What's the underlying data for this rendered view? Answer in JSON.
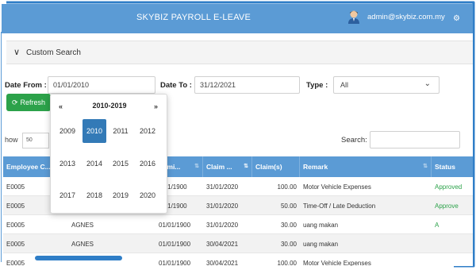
{
  "header": {
    "title": "SKYBIZ PAYROLL E-LEAVE",
    "user_email": "admin@skybiz.com.my",
    "icons": {
      "avatar": "user-avatar-icon",
      "settings": "gear-icon"
    },
    "colors": {
      "header_bg": "#5b9bd5"
    }
  },
  "search_panel": {
    "label": "Custom Search",
    "icon": "chevron-down-icon"
  },
  "filters": {
    "date_from": {
      "label": "Date From :",
      "value": "01/01/2010"
    },
    "date_to": {
      "label": "Date To :",
      "value": "31/12/2021"
    },
    "type": {
      "label": "Type :",
      "value": "All"
    }
  },
  "refresh_button": {
    "label": "Refresh",
    "icon": "refresh-icon",
    "color": "#2ca24a"
  },
  "table_controls": {
    "show_label": "how",
    "page_size": "50",
    "search_label": "Search:"
  },
  "datepicker": {
    "prev": "«",
    "next": "»",
    "title": "2010-2019",
    "years": [
      "2009",
      "2010",
      "2011",
      "2012",
      "2013",
      "2014",
      "2015",
      "2016",
      "2017",
      "2018",
      "2019",
      "2020"
    ],
    "selected": "2010"
  },
  "table": {
    "columns": [
      "Employee C...",
      "",
      "ubmi...",
      "Claim ...",
      "Claim(s)",
      "Remark",
      "Status"
    ],
    "rows": [
      {
        "employee": "E0005",
        "name": "",
        "submit": "1/01/1900",
        "claim_date": "31/01/2020",
        "amount": "100.00",
        "remark": "Motor Vehicle Expenses",
        "status": "Approved"
      },
      {
        "employee": "E0005",
        "name": "",
        "submit": "1/01/1900",
        "claim_date": "31/01/2020",
        "amount": "50.00",
        "remark": "Time-Off / Late Deduction",
        "status": "Approve"
      },
      {
        "employee": "E0005",
        "name": "AGNES",
        "submit": "01/01/1900",
        "claim_date": "31/01/2020",
        "amount": "30.00",
        "remark": "uang makan",
        "status": "A"
      },
      {
        "employee": "E0005",
        "name": "AGNES",
        "submit": "01/01/1900",
        "claim_date": "30/04/2021",
        "amount": "30.00",
        "remark": "uang makan",
        "status": ""
      },
      {
        "employee": "E0005",
        "name": "",
        "submit": "01/01/1900",
        "claim_date": "30/04/2021",
        "amount": "100.00",
        "remark": "Motor Vehicle Expenses",
        "status": ""
      }
    ],
    "colors": {
      "header_bg": "#5b9bd5",
      "status_approved": "#2ca24a"
    }
  }
}
